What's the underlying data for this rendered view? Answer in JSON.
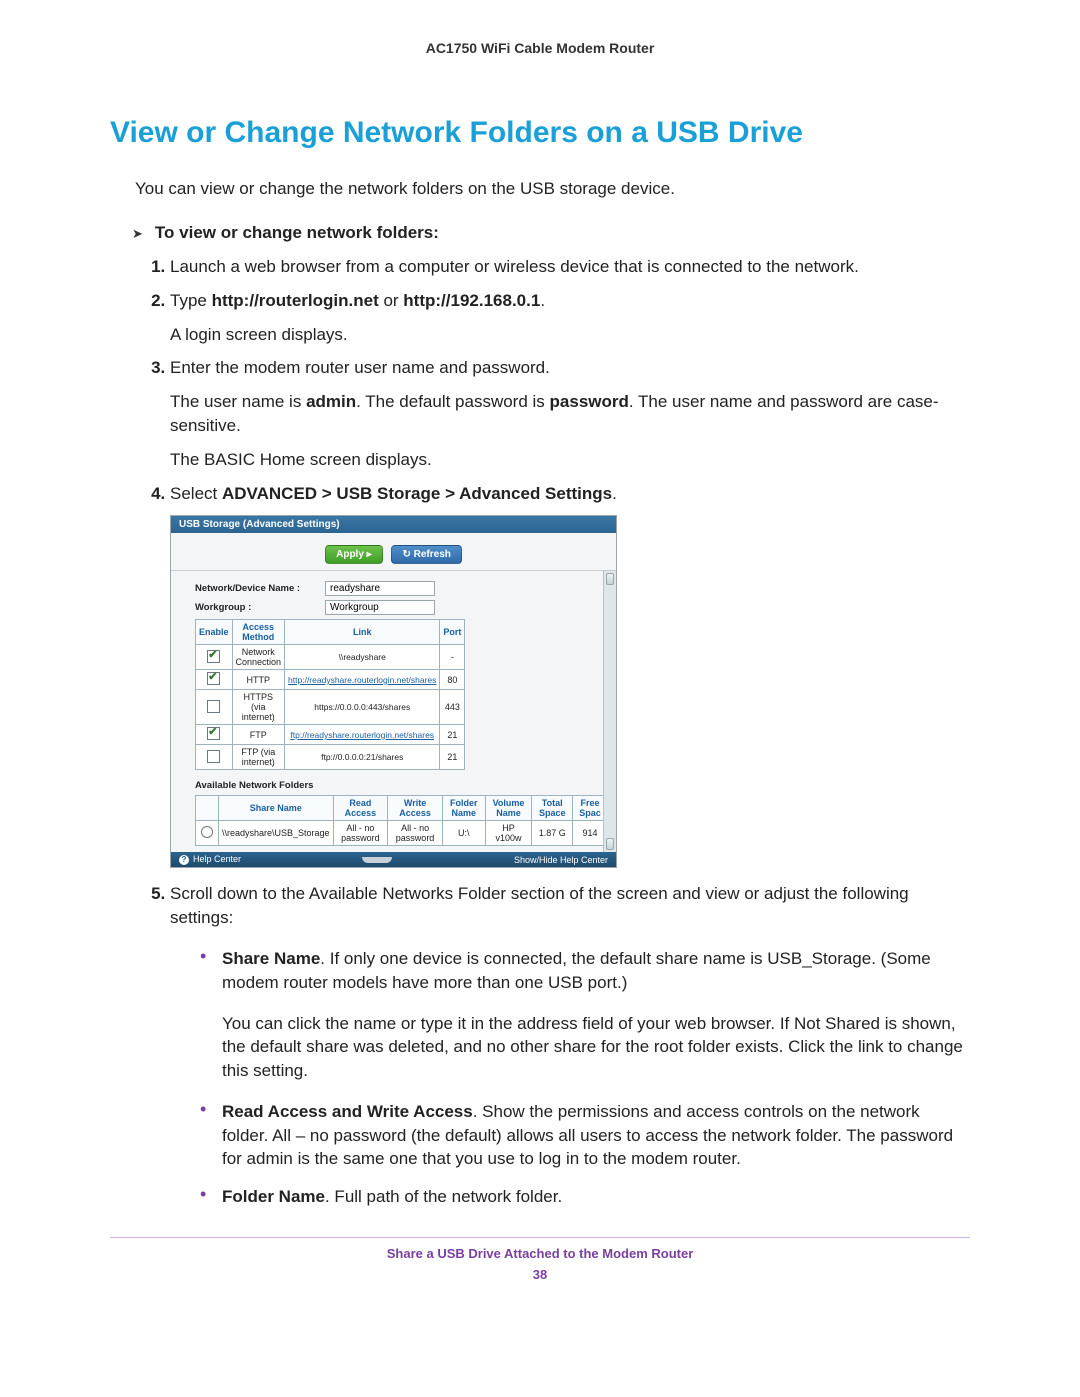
{
  "doc": {
    "running_head": "AC1750 WiFi Cable Modem Router",
    "title": "View or Change Network Folders on a USB Drive",
    "intro": "You can view or change the network folders on the USB storage device.",
    "procedure_label": "To view or change network folders:",
    "step1": "Launch a web browser from a computer or wireless device that is connected to the network.",
    "step2a": "Type ",
    "step2b": "http://routerlogin.net",
    "step2c": " or ",
    "step2d": "http://192.168.0.1",
    "step2e": ".",
    "step2f": "A login screen displays.",
    "step3a": "Enter the modem router user name and password.",
    "step3b_pre": "The user name is ",
    "step3b_admin": "admin",
    "step3b_mid": ". The default password is ",
    "step3b_pw": "password",
    "step3b_post": ". The user name and password are case-sensitive.",
    "step3c": "The BASIC Home screen displays.",
    "step4a": "Select ",
    "step4b": "ADVANCED > USB Storage > Advanced Settings",
    "step4c": ".",
    "step5": "Scroll down to the Available Networks Folder section of the screen and view or adjust the following settings:",
    "bullet1_bold": "Share Name",
    "bullet1a": ". If only one device is connected, the default share name is USB_Storage. (Some modem router models have more than one USB port.)",
    "bullet1b": "You can click the name or type it in the address field of your web browser. If Not Shared is shown, the default share was deleted, and no other share for the root folder exists. Click the link to change this setting.",
    "bullet2_bold": "Read Access and Write Access",
    "bullet2a": ". Show the permissions and access controls on the network folder. All – no password (the default) allows all users to access the network folder. The password for admin is the same one that you use to log in to the modem router.",
    "bullet3_bold": "Folder Name",
    "bullet3a": ". Full path of the network folder.",
    "footer_chapter": "Share a USB Drive Attached to the Modem Router",
    "footer_page": "38"
  },
  "ui": {
    "title": "USB Storage (Advanced Settings)",
    "apply": "Apply ▸",
    "refresh": "↻ Refresh",
    "name_label": "Network/Device Name :",
    "name_value": "readyshare",
    "workgroup_label": "Workgroup :",
    "workgroup_value": "Workgroup",
    "th_enable": "Enable",
    "th_method": "Access Method",
    "th_link": "Link",
    "th_port": "Port",
    "rows": [
      {
        "checked": true,
        "method": "Network Connection",
        "link": "\\\\readyshare",
        "is_link": false,
        "port": "-"
      },
      {
        "checked": true,
        "method": "HTTP",
        "link": "http://readyshare.routerlogin.net/shares",
        "is_link": true,
        "port": "80"
      },
      {
        "checked": false,
        "method": "HTTPS (via internet)",
        "link": "https://0.0.0.0:443/shares",
        "is_link": false,
        "port": "443"
      },
      {
        "checked": true,
        "method": "FTP",
        "link": "ftp://readyshare.routerlogin.net/shares",
        "is_link": true,
        "port": "21"
      },
      {
        "checked": false,
        "method": "FTP (via internet)",
        "link": "ftp://0.0.0.0:21/shares",
        "is_link": false,
        "port": "21"
      }
    ],
    "avail_head": "Available Network Folders",
    "th_share": "Share Name",
    "th_read": "Read Access",
    "th_write": "Write Access",
    "th_folder": "Folder Name",
    "th_volume": "Volume Name",
    "th_total": "Total Space",
    "th_free": "Free Spac",
    "folder": {
      "share": "\\\\readyshare\\USB_Storage",
      "read": "All - no password",
      "write": "All - no password",
      "folder": "U:\\",
      "volume": "HP v100w",
      "total": "1.87 G",
      "free": "914"
    },
    "help": "Help Center",
    "showhide": "Show/Hide Help Center"
  }
}
